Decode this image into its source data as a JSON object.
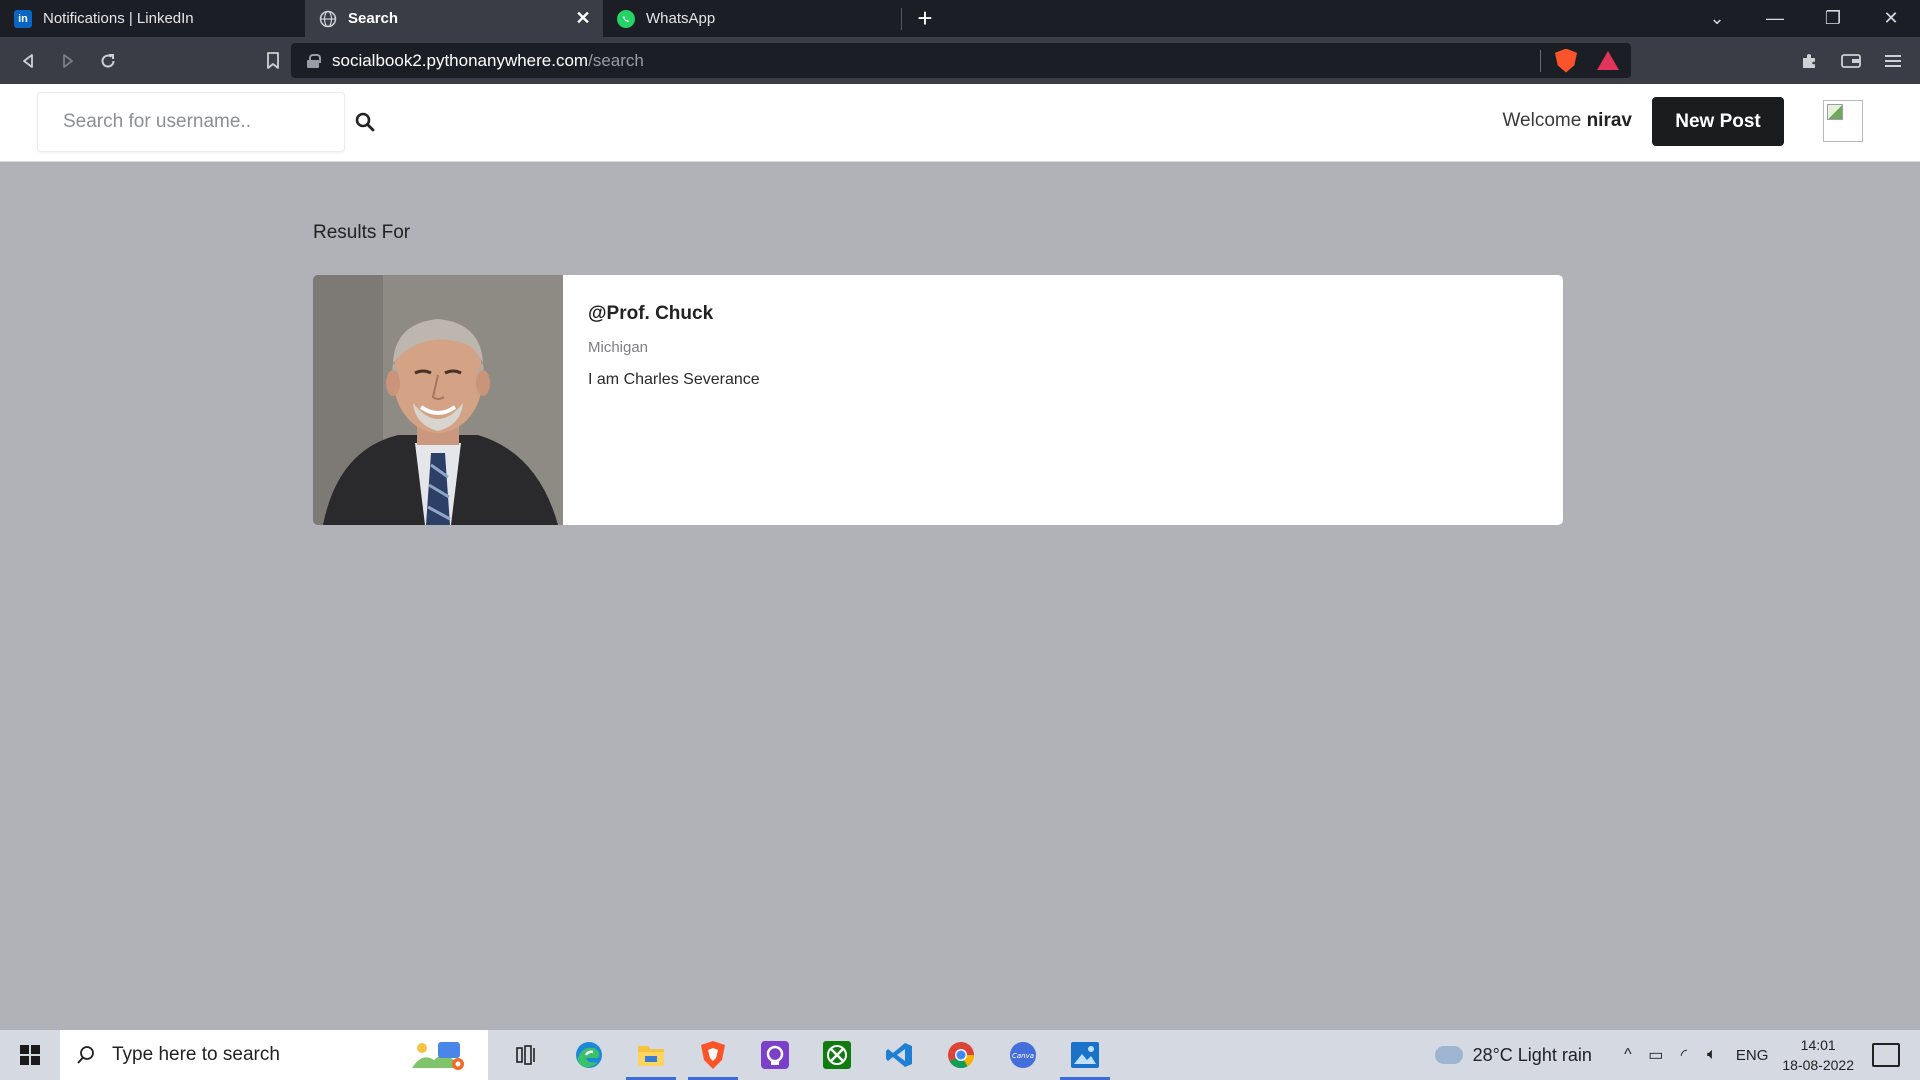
{
  "browser": {
    "tabs": [
      {
        "title": "Notifications | LinkedIn",
        "icon": "linkedin-icon"
      },
      {
        "title": "Search",
        "icon": "globe-icon",
        "active": true
      },
      {
        "title": "WhatsApp",
        "icon": "whatsapp-icon"
      }
    ],
    "url_host": "socialbook2.pythonanywhere.com",
    "url_path": "/search"
  },
  "header": {
    "search_placeholder": "Search for username..",
    "welcome_text": "Welcome",
    "username": "nirav",
    "new_post_label": "New Post"
  },
  "results": {
    "label": "Results For",
    "items": [
      {
        "handle": "@Prof. Chuck",
        "location": "Michigan",
        "bio": "I am Charles Severance"
      }
    ]
  },
  "taskbar": {
    "search_label": "Type here to search",
    "weather": "28°C  Light rain",
    "language": "ENG",
    "time": "14:01",
    "date": "18-08-2022"
  },
  "colors": {
    "page_bg": "#b0b2b7",
    "button_dark": "#1b1c1e",
    "tab_bar": "#1c1e25",
    "nav_bar": "#3a3d46"
  }
}
